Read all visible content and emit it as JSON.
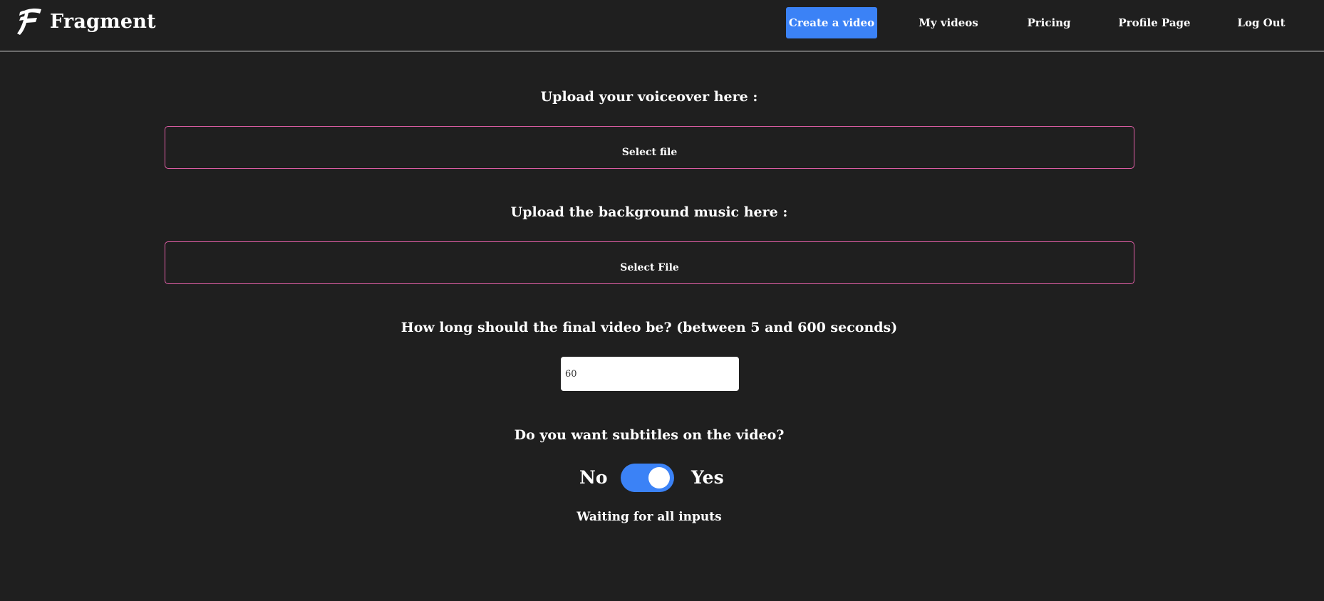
{
  "app": {
    "name": "Fragment",
    "logo_icon": "fragment-f-logo-icon"
  },
  "nav": {
    "create": "Create a video",
    "my_videos": "My videos",
    "pricing": "Pricing",
    "profile": "Profile Page",
    "logout": "Log Out",
    "active": "Create a video"
  },
  "form": {
    "voiceover": {
      "heading": "Upload your voiceover here :",
      "button_label": "Select file"
    },
    "music": {
      "heading": "Upload the background music here :",
      "button_label": "Select File"
    },
    "length": {
      "heading": "How long should the final video be? (between 5 and 600 seconds)",
      "value": "60"
    },
    "subtitles": {
      "heading": "Do you want subtitles on the video?",
      "off_label": "No",
      "on_label": "Yes",
      "enabled": true
    },
    "status": "Waiting for all inputs"
  },
  "colors": {
    "background": "#1f1f1f",
    "accent": "#3b82f6",
    "file_border": "#e05ea6",
    "divider": "#6b6b6b"
  }
}
